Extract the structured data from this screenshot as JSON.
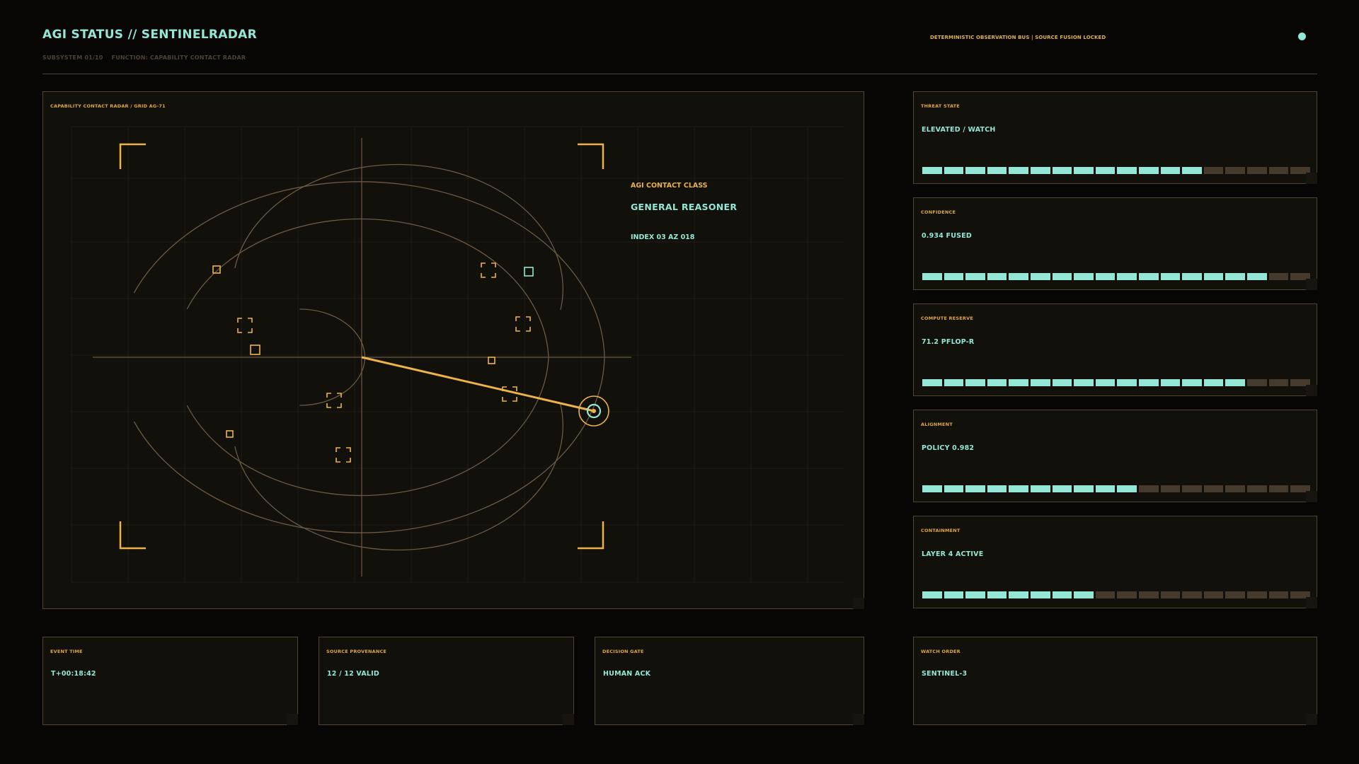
{
  "header": {
    "title": "AGI STATUS // SENTINELRADAR",
    "subsystem": "SUBSYSTEM 01/10",
    "function": "FUNCTION: CAPABILITY CONTACT RADAR",
    "bus_status": "DETERMINISTIC OBSERVATION BUS  |  SOURCE FUSION LOCKED"
  },
  "radar": {
    "label": "CAPABILITY CONTACT RADAR / GRID AG-71",
    "contact_class_label": "AGI CONTACT CLASS",
    "contact_class_value": "GENERAL REASONER",
    "contact_index": "INDEX 03  AZ 018"
  },
  "metrics": [
    {
      "label": "THREAT STATE",
      "value": "ELEVATED / WATCH",
      "level": 0.72
    },
    {
      "label": "CONFIDENCE",
      "value": "0.934 FUSED",
      "level": 0.89
    },
    {
      "label": "COMPUTE RESERVE",
      "value": "71.2 PFLOP-R",
      "level": 0.83
    },
    {
      "label": "ALIGNMENT",
      "value": "POLICY 0.982",
      "level": 0.56
    },
    {
      "label": "CONTAINMENT",
      "value": "LAYER 4 ACTIVE",
      "level": 0.44
    }
  ],
  "footer": [
    {
      "label": "EVENT TIME",
      "value": "T+00:18:42"
    },
    {
      "label": "SOURCE PROVENANCE",
      "value": "12 / 12 VALID"
    },
    {
      "label": "DECISION GATE",
      "value": "HUMAN ACK"
    },
    {
      "label": "WATCH ORDER",
      "value": "SENTINEL-3"
    }
  ],
  "colors": {
    "accent_teal": "#94e6d6",
    "accent_amber": "#e9b24a",
    "panel_bg": "#11100b",
    "page_bg": "#070605"
  }
}
